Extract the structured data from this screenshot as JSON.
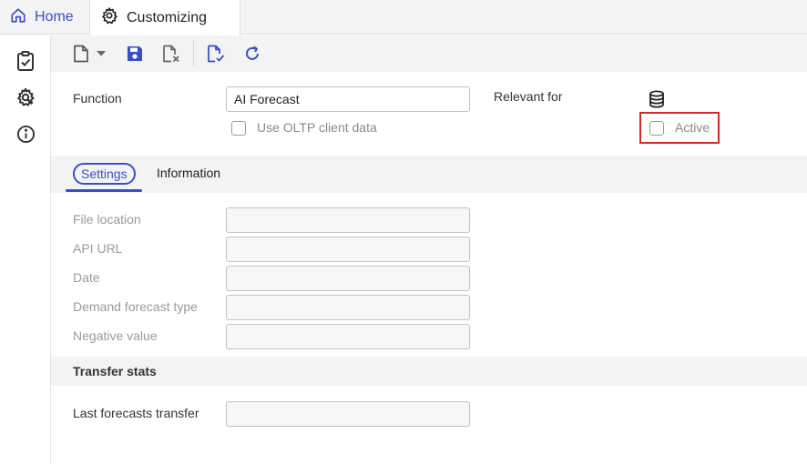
{
  "tabs": {
    "home_label": "Home",
    "customizing_label": "Customizing"
  },
  "header": {
    "function_label": "Function",
    "function_value": "AI Forecast",
    "use_oltp_label": "Use OLTP client data",
    "use_oltp_checked": false,
    "relevant_for_label": "Relevant for",
    "active_label": "Active",
    "active_checked": false
  },
  "subtabs": {
    "settings": "Settings",
    "information": "Information"
  },
  "settings_form": {
    "file_location_label": "File location",
    "file_location_value": "",
    "api_url_label": "API URL",
    "api_url_value": "",
    "date_label": "Date",
    "date_value": "",
    "demand_forecast_type_label": "Demand forecast type",
    "demand_forecast_type_value": "",
    "negative_value_label": "Negative value",
    "negative_value_value": ""
  },
  "transfer_stats": {
    "section_title": "Transfer stats",
    "last_transfer_label": "Last forecasts transfer",
    "last_transfer_value": ""
  },
  "icons": {
    "home": "home-icon",
    "customizing": "gear-icon",
    "sidebar": [
      "clipboard-check-icon",
      "settings-search-icon",
      "info-icon"
    ],
    "toolbar": [
      "new-document-icon",
      "dropdown-arrow-icon",
      "save-icon",
      "discard-document-icon",
      "validate-document-icon",
      "refresh-icon"
    ],
    "relevant_for": "database-icon"
  },
  "colors": {
    "accent": "#3a4fc4",
    "highlight_border": "#d62a2a"
  }
}
